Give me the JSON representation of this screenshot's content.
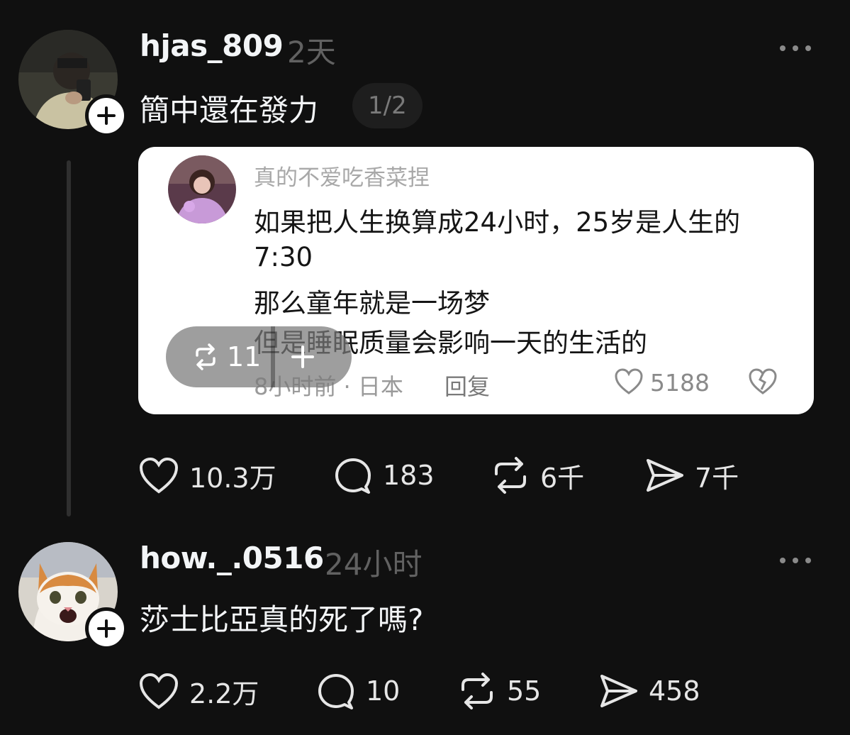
{
  "posts": [
    {
      "username": "hjas_809",
      "time": "2天",
      "text": "簡中還在發力",
      "page_indicator": "1/2",
      "avatar_icon": "user-photo-avatar",
      "embed": {
        "name": "真的不爱吃香菜捏",
        "lines": [
          "如果把人生换算成24小时，25岁是人生的",
          "7:30",
          "那么童年就是一场梦",
          "但是睡眠质量会影响一天的生活的"
        ],
        "meta": "8小时前 · 日本",
        "reply": "回复",
        "likes": "5188",
        "overlay_repost_count": "11"
      },
      "actions": {
        "likes": "10.3万",
        "comments": "183",
        "reposts": "6千",
        "shares": "7千"
      }
    },
    {
      "username": "how._.0516",
      "time": "24小时",
      "text": "莎士比亞真的死了嗎?",
      "avatar_icon": "cat-avatar",
      "actions": {
        "likes": "2.2万",
        "comments": "10",
        "reposts": "55",
        "shares": "458"
      }
    }
  ],
  "colors": {
    "background": "#101010",
    "primary_text": "#f3f5f7",
    "secondary_text": "#616161"
  }
}
